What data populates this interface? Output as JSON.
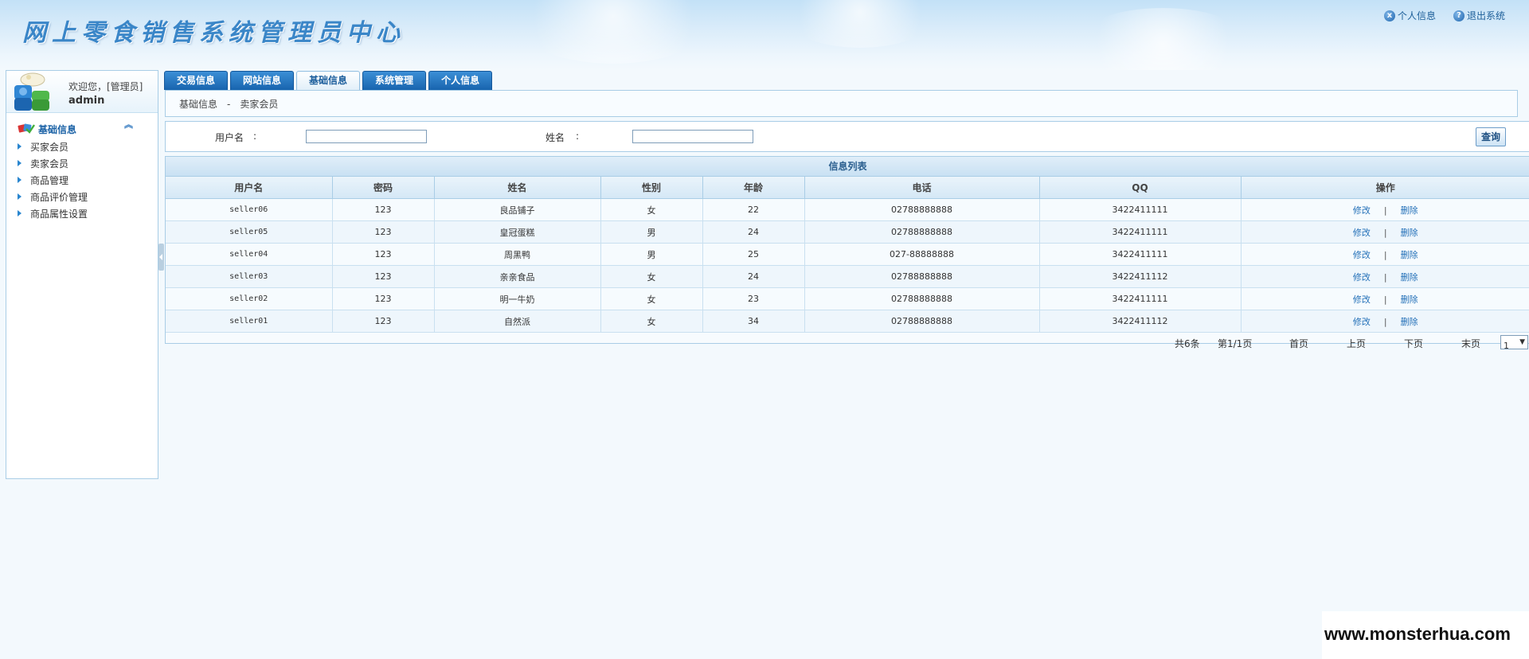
{
  "header": {
    "title": "网上零食销售系统管理员中心",
    "links": [
      {
        "label": "个人信息",
        "icon": "info-icon",
        "glyph": "x"
      },
      {
        "label": "退出系统",
        "icon": "help-icon",
        "glyph": "?"
      }
    ]
  },
  "sidebar": {
    "welcome": "欢迎您，[管理员]",
    "username": "admin",
    "section_title": "基础信息",
    "collapse_glyph": "^",
    "items": [
      {
        "label": "买家会员"
      },
      {
        "label": "卖家会员"
      },
      {
        "label": "商品管理"
      },
      {
        "label": "商品评价管理"
      },
      {
        "label": "商品属性设置"
      }
    ]
  },
  "tabs": [
    {
      "label": "交易信息"
    },
    {
      "label": "网站信息"
    },
    {
      "label": "基础信息",
      "active": true
    },
    {
      "label": "系统管理"
    },
    {
      "label": "个人信息"
    }
  ],
  "breadcrumb": {
    "parent": "基础信息",
    "separator": "-",
    "current": "卖家会员"
  },
  "search": {
    "username_label": "用户名",
    "name_label": "姓名",
    "colon": ":",
    "username_value": "",
    "name_value": "",
    "query_label": "查询"
  },
  "list": {
    "title": "信息列表",
    "columns": [
      "用户名",
      "密码",
      "姓名",
      "性别",
      "年龄",
      "电话",
      "QQ",
      "操作"
    ],
    "rows": [
      {
        "username": "seller06",
        "password": "123",
        "name": "良品铺子",
        "gender": "女",
        "age": "22",
        "phone": "02788888888",
        "qq": "3422411111"
      },
      {
        "username": "seller05",
        "password": "123",
        "name": "皇冠蛋糕",
        "gender": "男",
        "age": "24",
        "phone": "02788888888",
        "qq": "3422411111"
      },
      {
        "username": "seller04",
        "password": "123",
        "name": "周黑鸭",
        "gender": "男",
        "age": "25",
        "phone": "027-88888888",
        "qq": "3422411111"
      },
      {
        "username": "seller03",
        "password": "123",
        "name": "亲亲食品",
        "gender": "女",
        "age": "24",
        "phone": "02788888888",
        "qq": "3422411112"
      },
      {
        "username": "seller02",
        "password": "123",
        "name": "明一牛奶",
        "gender": "女",
        "age": "23",
        "phone": "02788888888",
        "qq": "3422411111"
      },
      {
        "username": "seller01",
        "password": "123",
        "name": "自然派",
        "gender": "女",
        "age": "34",
        "phone": "02788888888",
        "qq": "3422411112"
      }
    ],
    "edit_label": "修改",
    "delete_label": "删除",
    "op_separator": "|"
  },
  "pager": {
    "total": "共6条",
    "page_info": "第1/1页",
    "first": "首页",
    "prev": "上页",
    "next": "下页",
    "last": "末页",
    "current_page": "1",
    "dropdown_glyph": "▼"
  },
  "watermark": "www.monsterhua.com",
  "colors": {
    "tab_blue": "#1f6fb8",
    "link_blue": "#2370b8",
    "border_blue": "#a9cde6",
    "background": "#f3f9fd"
  }
}
